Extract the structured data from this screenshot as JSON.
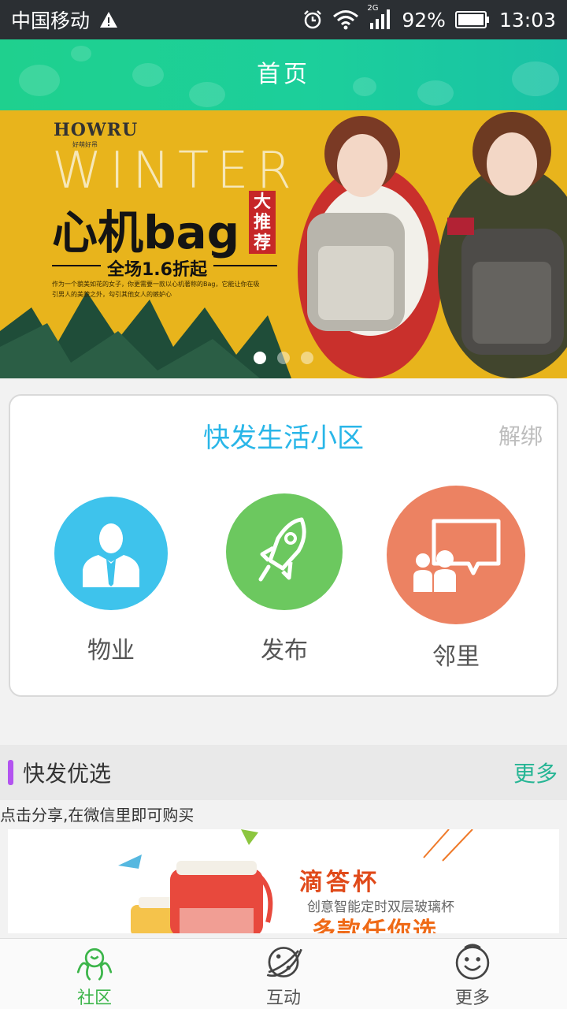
{
  "status_bar": {
    "carrier": "中国移动",
    "network": "2G",
    "battery": "92%",
    "time": "13:03",
    "icons": [
      "alert-icon",
      "alarm-icon",
      "wifi-icon",
      "signal-icon",
      "battery-icon"
    ]
  },
  "header": {
    "title": "首页"
  },
  "banner": {
    "brand": "HOWRU",
    "brand_sub": "好萌好吊",
    "season": "WINTER",
    "headline": "心机bag",
    "tag": "大推荐",
    "promo": "全场1.6折起",
    "description": "作为一个貌美如花的女子，你更需要一款以心机著称的Bag，它能让你在吸引男人的美貌之外，勾引其他女人的嫉妒心",
    "slide_count": 3,
    "active_slide": 1
  },
  "community": {
    "title": "快发生活小区",
    "unbind": "解绑",
    "services": [
      {
        "label": "物业",
        "color": "#3ec3ec",
        "icon": "manager-icon"
      },
      {
        "label": "发布",
        "color": "#6cc85f",
        "icon": "rocket-icon"
      },
      {
        "label": "邻里",
        "color": "#ec8262",
        "icon": "neighbors-icon"
      }
    ]
  },
  "featured": {
    "title": "快发优选",
    "more": "更多",
    "tip": "点击分享,在微信里即可购买",
    "product": {
      "name": "滴答杯",
      "subtitle": "创意智能定时双层玻璃杯",
      "slogan": "多款任你选"
    }
  },
  "tab_bar": {
    "active": 0,
    "tabs": [
      {
        "label": "社区",
        "icon": "community-icon"
      },
      {
        "label": "互动",
        "icon": "planet-icon"
      },
      {
        "label": "更多",
        "icon": "smiley-icon"
      }
    ]
  },
  "colors": {
    "header": "#1fd08e",
    "accent": "#26b594",
    "community_title": "#29b6e8",
    "section_bar": "#b353f0",
    "active_tab": "#3cb54a"
  }
}
